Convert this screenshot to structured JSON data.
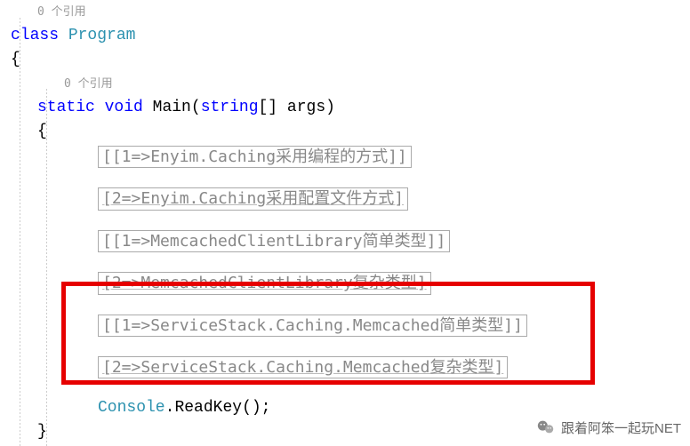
{
  "refs": {
    "class_ref": "0 个引用",
    "method_ref": "0 个引用"
  },
  "code": {
    "class_kw": "class",
    "class_name": "Program",
    "brace_open": "{",
    "brace_close": "}",
    "static_kw": "static",
    "void_kw": "void",
    "main_name": "Main",
    "paren_open": "(",
    "string_type": "string",
    "array_brackets": "[]",
    "args_name": " args",
    "paren_close": ")",
    "method_brace_open": "{",
    "method_brace_close": "}",
    "console": "Console",
    "dot": ".",
    "readkey": "ReadKey",
    "call_parens": "()",
    "semicolon": ";"
  },
  "regions": [
    "[1=>Enyim.Caching采用编程的方式]",
    "2=>Enyim.Caching采用配置文件方式",
    "[1=>MemcachedClientLibrary简单类型]",
    "2=>MemcachedClientLibrary复杂类型",
    "[1=>ServiceStack.Caching.Memcached简单类型]",
    "2=>ServiceStack.Caching.Memcached复杂类型"
  ],
  "watermark": "跟着阿笨一起玩NET"
}
